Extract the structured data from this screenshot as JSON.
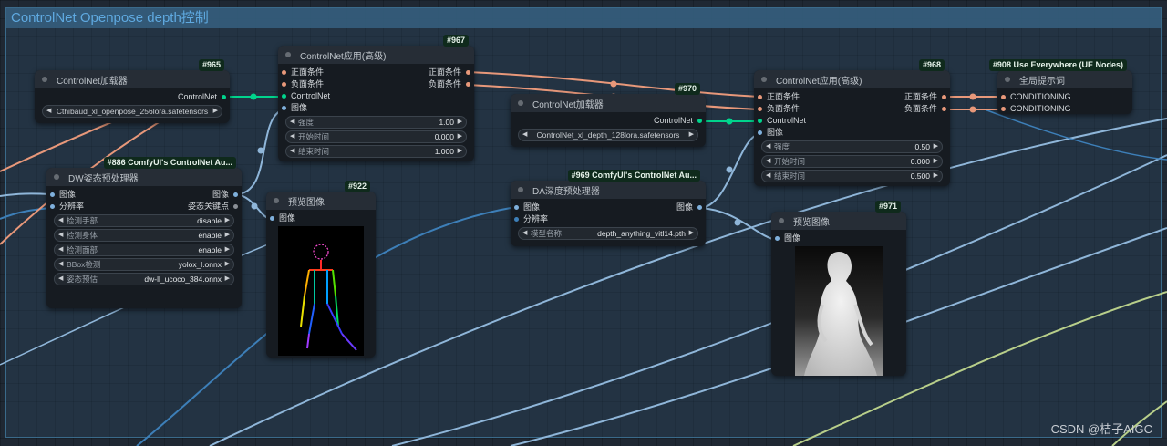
{
  "group": {
    "title": "ControlNet Openpose depth控制"
  },
  "colors": {
    "conditioning": "#e8987a",
    "controlnet": "#00d48c",
    "image": "#7fb0dc"
  },
  "nodes": {
    "n965": {
      "badge": "#965",
      "title": "ControlNet加载器",
      "output": "ControlNet",
      "model": "Cthibaud_xl_openpose_256lora.safetensors"
    },
    "n967": {
      "badge": "#967",
      "title": "ControlNet应用(高级)",
      "inputs": [
        "正面条件",
        "负面条件",
        "ControlNet",
        "图像"
      ],
      "outputs": [
        "正面条件",
        "负面条件"
      ],
      "widgets": [
        {
          "label": "强度",
          "value": "1.00"
        },
        {
          "label": "开始时间",
          "value": "0.000"
        },
        {
          "label": "结束时间",
          "value": "1.000"
        }
      ]
    },
    "n886": {
      "badge": "#886 ComfyUI's ControlNet Au...",
      "title": "DW姿态预处理器",
      "inputs": [
        "图像",
        "分辨率"
      ],
      "outputs": [
        "图像",
        "姿态关键点"
      ],
      "widgets": [
        {
          "label": "检测手部",
          "value": "disable"
        },
        {
          "label": "检测身体",
          "value": "enable"
        },
        {
          "label": "检测面部",
          "value": "enable"
        },
        {
          "label": "BBox检测",
          "value": "yolox_l.onnx"
        },
        {
          "label": "姿态预估",
          "value": "dw-ll_ucoco_384.onnx"
        }
      ]
    },
    "n922": {
      "badge": "#922",
      "title": "预览图像",
      "input": "图像"
    },
    "n970": {
      "badge": "#970",
      "title": "ControlNet加载器",
      "output": "ControlNet",
      "model": "ControlNet_xl_depth_128lora.safetensors"
    },
    "n969": {
      "badge": "#969 ComfyUI's ControlNet Au...",
      "title": "DA深度预处理器",
      "inputs": [
        "图像",
        "分辨率"
      ],
      "output": "图像",
      "widgets": [
        {
          "label": "模型名称",
          "value": "depth_anything_vitl14.pth"
        }
      ]
    },
    "n968": {
      "badge": "#968",
      "title": "ControlNet应用(高级)",
      "inputs": [
        "正面条件",
        "负面条件",
        "ControlNet",
        "图像"
      ],
      "outputs": [
        "正面条件",
        "负面条件"
      ],
      "widgets": [
        {
          "label": "强度",
          "value": "0.50"
        },
        {
          "label": "开始时间",
          "value": "0.000"
        },
        {
          "label": "结束时间",
          "value": "0.500"
        }
      ]
    },
    "n971": {
      "badge": "#971",
      "title": "预览图像",
      "input": "图像"
    },
    "n908": {
      "badge": "#908 Use Everywhere (UE Nodes)",
      "title": "全局提示词",
      "inputs": [
        "CONDITIONING",
        "CONDITIONING"
      ]
    }
  },
  "watermark": "CSDN @桔子AIGC"
}
